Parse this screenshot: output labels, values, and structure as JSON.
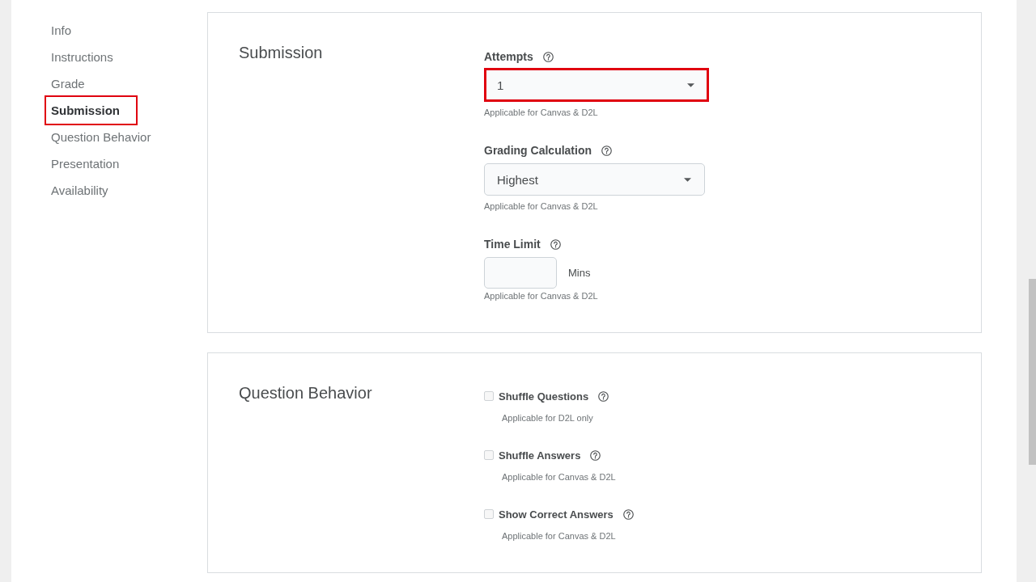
{
  "sidebar": {
    "items": [
      {
        "label": "Info",
        "selected": false,
        "highlighted": false
      },
      {
        "label": "Instructions",
        "selected": false,
        "highlighted": false
      },
      {
        "label": "Grade",
        "selected": false,
        "highlighted": false
      },
      {
        "label": "Submission",
        "selected": true,
        "highlighted": true
      },
      {
        "label": "Question Behavior",
        "selected": false,
        "highlighted": false
      },
      {
        "label": "Presentation",
        "selected": false,
        "highlighted": false
      },
      {
        "label": "Availability",
        "selected": false,
        "highlighted": false
      }
    ]
  },
  "sections": [
    {
      "title": "Submission",
      "fields": [
        {
          "kind": "select",
          "label": "Attempts",
          "value": "1",
          "hint": "Applicable for Canvas & D2L",
          "highlighted": true
        },
        {
          "kind": "select",
          "label": "Grading Calculation",
          "value": "Highest",
          "hint": "Applicable for Canvas & D2L",
          "highlighted": false
        },
        {
          "kind": "number",
          "label": "Time Limit",
          "unit": "Mins",
          "hint": "Applicable for Canvas & D2L",
          "highlighted": false
        }
      ]
    },
    {
      "title": "Question Behavior",
      "fields": [
        {
          "kind": "checkbox",
          "label": "Shuffle Questions",
          "checked": false,
          "hint": "Applicable for D2L only",
          "highlighted": false
        },
        {
          "kind": "checkbox",
          "label": "Shuffle Answers",
          "checked": false,
          "hint": "Applicable for Canvas & D2L",
          "highlighted": false
        },
        {
          "kind": "checkbox",
          "label": "Show Correct Answers",
          "checked": false,
          "hint": "Applicable for Canvas & D2L",
          "highlighted": false
        }
      ]
    }
  ]
}
